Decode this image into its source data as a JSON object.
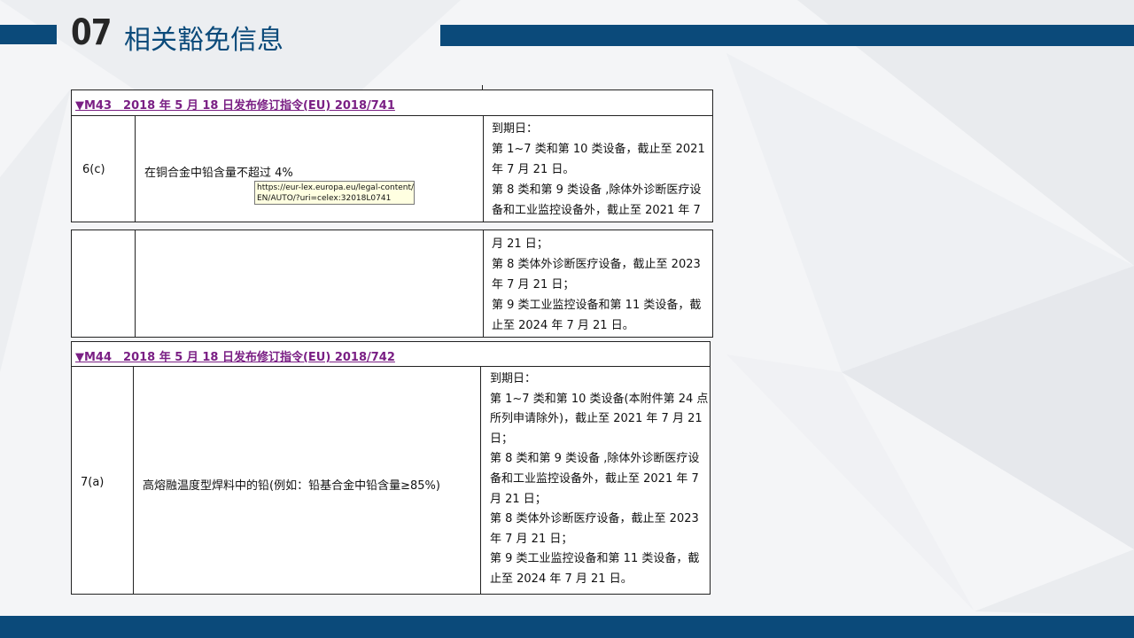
{
  "slide": {
    "number": "07",
    "title": "相关豁免信息"
  },
  "m43": {
    "header": "▼M43　2018 年 5 月 18 日发布修订指令(EU) 2018/741",
    "row_id": "6(c)",
    "description": "在铜合金中铅含量不超过 4%",
    "expiry_part1": [
      "到期日：",
      "第 1~7 类和第 10 类设备，截止至 2021",
      "年 7 月 21 日。",
      "第 8 类和第 9 类设备 ,除体外诊断医疗设",
      "备和工业监控设备外，截止至 2021 年 7"
    ],
    "expiry_part2": [
      "月 21 日；",
      "第 8 类体外诊断医疗设备，截止至 2023",
      "年 7 月 21 日；",
      "第 9 类工业监控设备和第 11 类设备，截",
      "止至 2024 年 7 月 21 日。"
    ],
    "tooltip": [
      "https://eur-lex.europa.eu/legal-content/",
      "EN/AUTO/?uri=celex:32018L0741"
    ]
  },
  "m44": {
    "header": "▼M44　2018 年 5 月 18 日发布修订指令(EU) 2018/742",
    "row_id": "7(a)",
    "description": "高熔融温度型焊料中的铅(例如：铅基合金中铅含量≥85%)",
    "expiry": [
      "到期日：",
      "第 1~7 类和第 10 类设备(本附件第 24 点",
      "所列申请除外)，截止至 2021 年 7 月 21",
      "日；",
      "第 8 类和第 9 类设备 ,除体外诊断医疗设",
      "备和工业监控设备外，截止至 2021 年 7",
      "月 21 日；",
      "第 8 类体外诊断医疗设备，截止至 2023",
      "年 7 月 21 日；",
      "第 9 类工业监控设备和第 11 类设备，截",
      "止至 2024 年 7 月 21 日。"
    ]
  },
  "colors": {
    "accent": "#0b4a7a",
    "header_text": "#7a1f84"
  }
}
